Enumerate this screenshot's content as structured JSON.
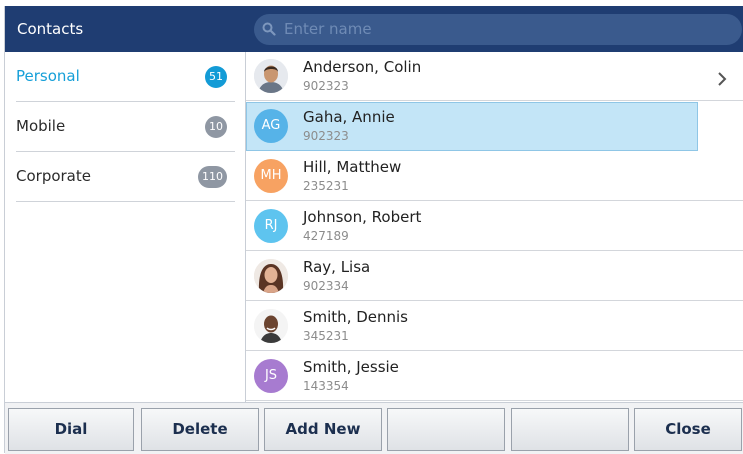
{
  "header": {
    "title": "Contacts",
    "search_placeholder": "Enter name"
  },
  "categories": [
    {
      "label": "Personal",
      "count": "51",
      "active": true
    },
    {
      "label": "Mobile",
      "count": "10",
      "active": false
    },
    {
      "label": "Corporate",
      "count": "110",
      "active": false
    }
  ],
  "contacts": [
    {
      "name": "Anderson, Colin",
      "number": "902323",
      "avatar": "photo"
    },
    {
      "name": "Gaha, Annie",
      "number": "902323",
      "initials": "AG",
      "color": "#56b3e8",
      "selected": true
    },
    {
      "name": "Hill, Matthew",
      "number": "235231",
      "initials": "MH",
      "color": "#f7a262"
    },
    {
      "name": "Johnson, Robert",
      "number": "427189",
      "initials": "RJ",
      "color": "#5ec4ef"
    },
    {
      "name": "Ray, Lisa",
      "number": "902334",
      "avatar": "photo"
    },
    {
      "name": "Smith, Dennis",
      "number": "345231",
      "avatar": "photo"
    },
    {
      "name": "Smith, Jessie",
      "number": "143354",
      "initials": "JS",
      "color": "#a77bd0"
    }
  ],
  "softkeys": [
    "Dial",
    "Delete",
    "Add New",
    "",
    "",
    "Close"
  ],
  "colors": {
    "header": "#1f3d72",
    "accent": "#159fd8",
    "selected_row": "#c3e5f7"
  }
}
